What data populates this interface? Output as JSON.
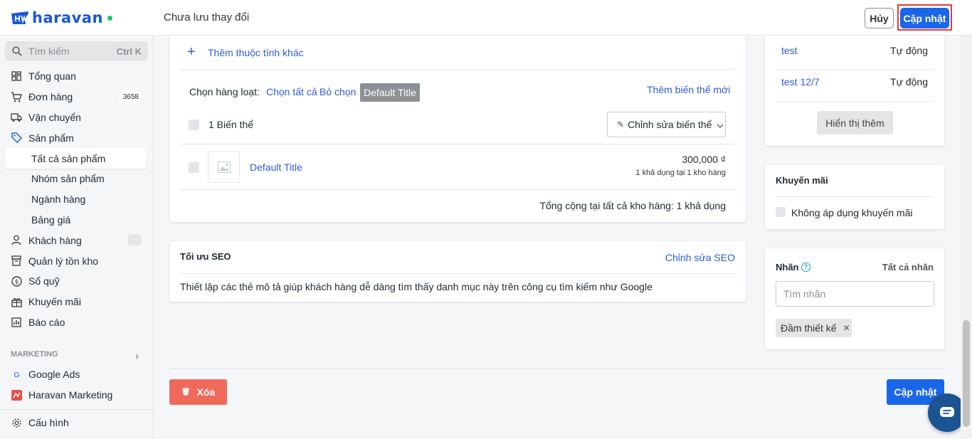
{
  "brand": {
    "name": "haravan",
    "status_color": "#22c55e",
    "accent": "#1a66e8"
  },
  "header": {
    "status": "Chưa lưu thay đổi",
    "cancel_label": "Hủy",
    "update_label": "Cập nhật"
  },
  "sidebar": {
    "search": {
      "placeholder": "Tìm kiếm",
      "shortcut": "Ctrl K"
    },
    "items": [
      {
        "label": "Tổng quan",
        "icon": "dashboard-icon"
      },
      {
        "label": "Đơn hàng",
        "icon": "cart-icon",
        "badge": "3658"
      },
      {
        "label": "Vận chuyển",
        "icon": "truck-icon"
      },
      {
        "label": "Sản phẩm",
        "icon": "tag-icon"
      },
      {
        "label": "Tất cả sản phẩm",
        "sub": true,
        "active": true
      },
      {
        "label": "Nhóm sản phẩm",
        "sub": true
      },
      {
        "label": "Ngành hàng",
        "sub": true
      },
      {
        "label": "Bảng giá",
        "sub": true
      },
      {
        "label": "Khách hàng",
        "icon": "person-icon"
      },
      {
        "label": "Quản lý tồn kho",
        "icon": "inventory-icon"
      },
      {
        "label": "Sổ quỹ",
        "icon": "dollar-icon"
      },
      {
        "label": "Khuyến mãi",
        "icon": "gift-icon"
      },
      {
        "label": "Báo cáo",
        "icon": "chart-icon"
      }
    ],
    "marketing_heading": "MARKETING",
    "marketing_items": [
      {
        "label": "Google Ads",
        "icon": "google-icon"
      },
      {
        "label": "Haravan Marketing",
        "icon": "haravan-marketing-icon"
      }
    ],
    "settings_label": "Cấu hình"
  },
  "variants": {
    "add_attribute": "Thêm thuộc tính khác",
    "bulk_select_label": "Chọn hàng loạt:",
    "select_all": "Chọn tất cả",
    "deselect": "Bỏ chọn",
    "option_pill": "Default Title",
    "add_variant": "Thêm biến thể mới",
    "count_label": "1 Biến thể",
    "edit_button": "Chỉnh sửa biến thể",
    "rows": [
      {
        "title": "Default Title",
        "price": "300,000 ₫",
        "stock": "1 khả dụng tại 1 kho hàng"
      }
    ],
    "total": "Tổng cộng tại tất cả kho hàng: 1 khả dụng"
  },
  "seo": {
    "title": "Tối ưu SEO",
    "edit_link": "Chỉnh sửa SEO",
    "description": "Thiết lập các thẻ mô tả giúp khách hàng dễ dàng tìm thấy danh mục này trên công cụ tìm kiếm như Google"
  },
  "channels": {
    "rows": [
      {
        "name": "test",
        "mode": "Tự động"
      },
      {
        "name": "test 12/7",
        "mode": "Tự động"
      }
    ],
    "show_more": "Hiển thị thêm"
  },
  "promotion": {
    "title": "Khuyến mãi",
    "option": "Không áp dụng khuyến mãi"
  },
  "tags": {
    "title": "Nhãn",
    "all_link": "Tất cả nhãn",
    "placeholder": "Tìm nhãn",
    "items": [
      "Đầm thiết kế"
    ]
  },
  "footer": {
    "delete_label": "Xóa",
    "update_label": "Cập nhật"
  }
}
